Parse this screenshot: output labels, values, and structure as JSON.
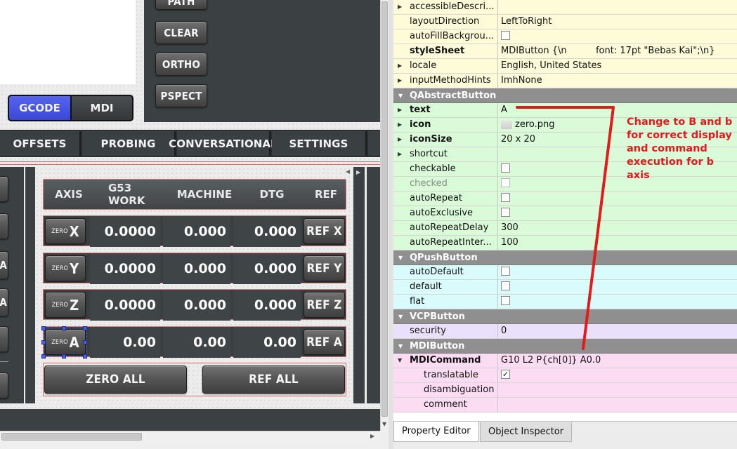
{
  "left_buttons": {
    "path": "PATH",
    "clear": "CLEAR",
    "ortho": "ORTHO",
    "pspect": "PSPECT"
  },
  "mode_toggle": {
    "gcode": "GCODE",
    "mdi": "MDI"
  },
  "tabs": [
    {
      "label": "OFFSETS"
    },
    {
      "label": "PROBING"
    },
    {
      "label": "CONVERSATIONAL"
    },
    {
      "label": "SETTINGS"
    }
  ],
  "side_button_fragments": [
    "/A",
    "/A"
  ],
  "dro": {
    "headers": {
      "axis": "AXIS",
      "work": "G53 WORK",
      "machine": "MACHINE",
      "dtg": "DTG",
      "ref": "REF"
    },
    "zero_small": "ZERO",
    "rows": [
      {
        "axis": "X",
        "work": "0.0000",
        "machine": "0.000",
        "dtg": "0.000",
        "ref": "REF X"
      },
      {
        "axis": "Y",
        "work": "0.0000",
        "machine": "0.000",
        "dtg": "0.000",
        "ref": "REF Y"
      },
      {
        "axis": "Z",
        "work": "0.0000",
        "machine": "0.000",
        "dtg": "0.000",
        "ref": "REF Z"
      },
      {
        "axis": "A",
        "work": "0.00",
        "machine": "0.00",
        "dtg": "0.00",
        "ref": "REF A"
      }
    ],
    "zero_all": "ZERO ALL",
    "ref_all": "REF ALL"
  },
  "property_editor": {
    "rows_top": [
      {
        "name": "accessibleDescri...",
        "value": "",
        "arrow": true
      },
      {
        "name": "layoutDirection",
        "value": "LeftToRight"
      },
      {
        "name": "autoFillBackgrou...",
        "checkbox": ""
      },
      {
        "name": "styleSheet",
        "value": "MDIButton {\\n          font: 17pt \"Bebas Kai\";\\n}",
        "bold": true
      },
      {
        "name": "locale",
        "value": "English, United States",
        "arrow": true
      },
      {
        "name": "inputMethodHints",
        "value": "ImhNone",
        "arrow": true
      }
    ],
    "sections": {
      "qabstractbutton": "QAbstractButton",
      "qpushbutton": "QPushButton",
      "vcpbutton": "VCPButton",
      "mdibutton": "MDIButton"
    },
    "abstract_rows": [
      {
        "name": "text",
        "value": "A",
        "bold": true,
        "arrow": true
      },
      {
        "name": "icon",
        "value": "zero.png",
        "bold": true,
        "arrow": true,
        "icon_prefix": ""
      },
      {
        "name": "iconSize",
        "value": "20 x 20",
        "bold": true,
        "arrow": true
      },
      {
        "name": "shortcut",
        "value": "",
        "arrow": true
      },
      {
        "name": "checkable",
        "checkbox": ""
      },
      {
        "name": "checked",
        "checkbox": "",
        "dim": true
      },
      {
        "name": "autoRepeat",
        "checkbox": ""
      },
      {
        "name": "autoExclusive",
        "checkbox": ""
      },
      {
        "name": "autoRepeatDelay",
        "value": "300"
      },
      {
        "name": "autoRepeatInter...",
        "value": "100"
      }
    ],
    "push_rows": [
      {
        "name": "autoDefault",
        "checkbox": ""
      },
      {
        "name": "default",
        "checkbox": ""
      },
      {
        "name": "flat",
        "checkbox": ""
      }
    ],
    "vcp_rows": [
      {
        "name": "security",
        "value": "0"
      }
    ],
    "mdi_rows": [
      {
        "name": "MDICommand",
        "value": "G10 L2 P{ch[0]} A0.0",
        "bold": true
      },
      {
        "name": "translatable",
        "checkbox": "✓",
        "sub": true
      },
      {
        "name": "disambiguation",
        "value": "",
        "sub": true
      },
      {
        "name": "comment",
        "value": "",
        "sub": true
      }
    ]
  },
  "bottom_tabs": {
    "property_editor": "Property Editor",
    "object_inspector": "Object Inspector"
  },
  "annotation": {
    "line1": "Change to B and b",
    "line2": "for correct display",
    "line3": "and command",
    "line4": "execution for b axis"
  },
  "colors": {
    "annotation": "#e01b1b",
    "toggle_active": "#3f4ee0",
    "accent_blue": "#4b62e0"
  }
}
